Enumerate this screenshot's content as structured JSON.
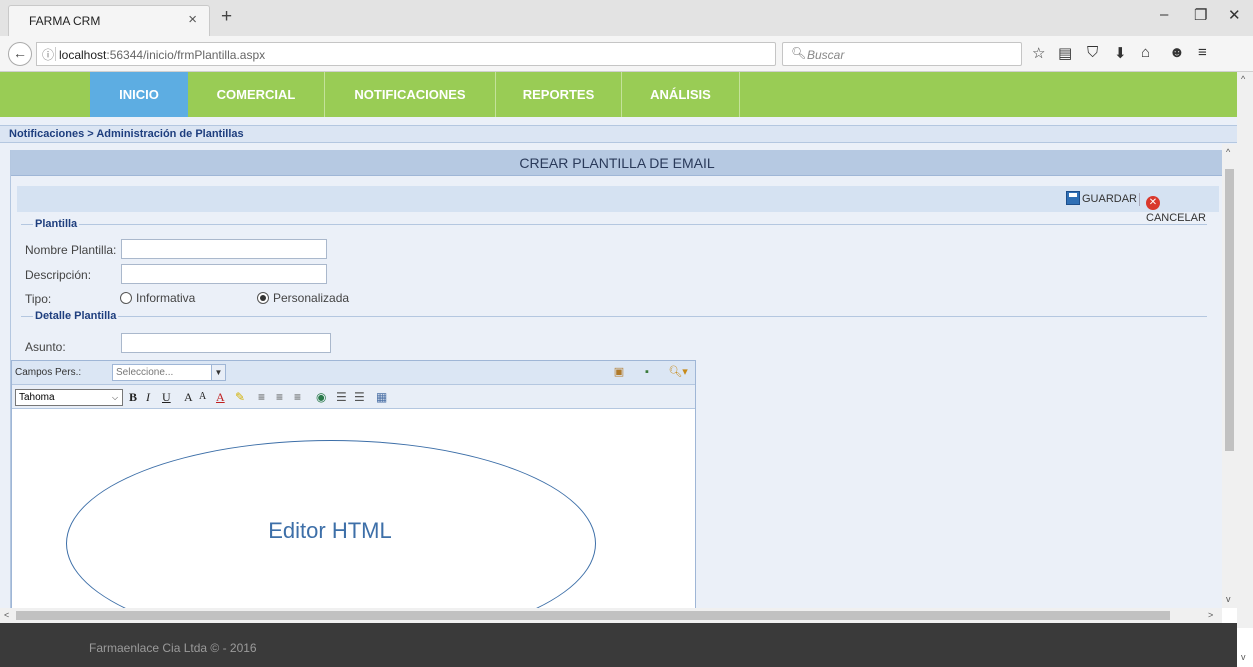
{
  "browser": {
    "tab_title": "FARMA CRM",
    "tab_close": "×",
    "new_tab": "+",
    "url_host": "localhost",
    "url_rest": ":56344/inicio/frmPlantilla.aspx",
    "search_placeholder": "Buscar",
    "window": {
      "minimize": "–",
      "maximize": "❐",
      "close": "✕"
    },
    "toolbar_icons": [
      "star-icon",
      "reading-list-icon",
      "pocket-icon",
      "download-icon",
      "home-icon",
      "feedback-icon",
      "menu-icon"
    ]
  },
  "menu": {
    "items": [
      {
        "label": "INICIO"
      },
      {
        "label": "COMERCIAL"
      },
      {
        "label": "NOTIFICACIONES"
      },
      {
        "label": "REPORTES"
      },
      {
        "label": "ANÁLISIS"
      }
    ],
    "active": "INICIO",
    "bg_color": "#99cc55",
    "active_color": "#5dade2"
  },
  "breadcrumb": "Notificaciones > Administración de Plantillas",
  "panel": {
    "title": "CREAR PLANTILLA DE EMAIL",
    "save_label": "GUARDAR",
    "cancel_label": "CANCELAR"
  },
  "form": {
    "section_template": "Plantilla",
    "name_label": "Nombre Plantilla:",
    "name_value": "",
    "description_label": "Descripción:",
    "description_value": "",
    "type_label": "Tipo:",
    "type_options": [
      "Informativa",
      "Personalizada"
    ],
    "type_selected": "Personalizada",
    "section_detail": "Detalle Plantilla",
    "subject_label": "Asunto:",
    "subject_value": ""
  },
  "editor": {
    "custom_fields_label": "Campos Pers.:",
    "custom_fields_value": "Seleccione...",
    "font_value": "Tahoma",
    "annotation": "Editor HTML"
  },
  "footer": {
    "text": "Farmaenlace Cia Ltda © - 2016"
  }
}
